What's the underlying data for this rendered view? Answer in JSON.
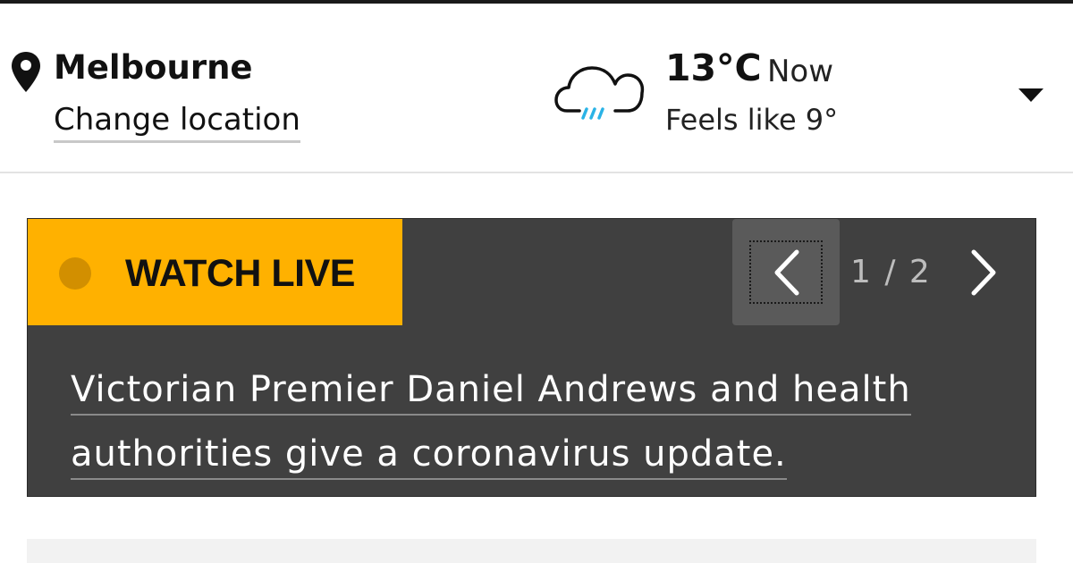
{
  "location": {
    "city": "Melbourne",
    "change_label": "Change location",
    "icon": "map-pin-icon"
  },
  "weather": {
    "temperature": "13°C",
    "time_label": "Now",
    "feels_like": "Feels like 9°",
    "icon": "rain-cloud-icon",
    "dropdown_icon": "caret-down-icon"
  },
  "live": {
    "badge_label": "WATCH LIVE",
    "counter": "1 / 2",
    "headline": "Victorian Premier Daniel Andrews and health authorities give a coronavirus update.",
    "prev_icon": "chevron-left-icon",
    "next_icon": "chevron-right-icon"
  },
  "colors": {
    "live_badge": "#ffb100",
    "live_dot": "#d28f00",
    "panel_background": "#404040",
    "rain_accent": "#2ab3e6"
  }
}
